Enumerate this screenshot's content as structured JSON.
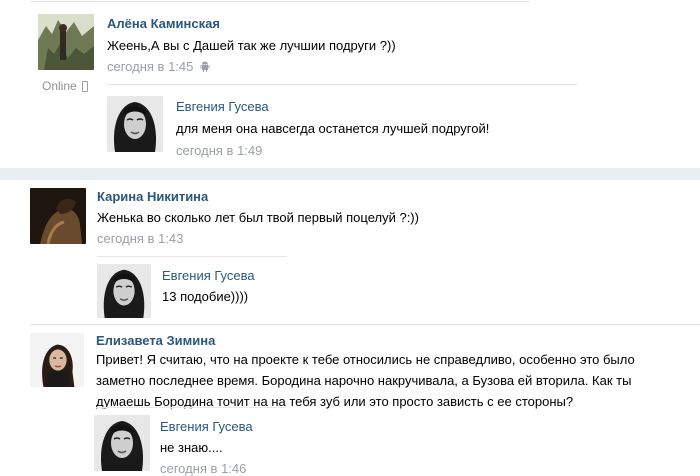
{
  "thread_1": {
    "author": "Алёна Каминская",
    "text": "Жеень,А вы с Дашей так же лучшии подруги ?))",
    "date": "сегодня в 1:45",
    "online": "Online",
    "reply": {
      "author": "Евгения Гусева",
      "text": "для меня она навсегда останется лучшей подругой!",
      "date": "сегодня в 1:49"
    }
  },
  "thread_2": {
    "author": "Карина Никитина",
    "text": "Женька во сколько лет был твой первый поцелуй ?:))",
    "date": "сегодня в 1:43",
    "reply": {
      "author": "Евгения Гусева",
      "text": "13 подобие))))"
    }
  },
  "thread_3": {
    "author": "Елизавета Зимина",
    "text": "Привет! Я считаю, что на проекте к тебе относились не справедливо, особенно это было заметно последнее время. Бородина нарочно накручивала, а Бузова ей вторила. Как ты думаешь Бородина точит на на тебя зуб или это просто зависть с ее стороны?",
    "reply": {
      "author": "Евгения Гусева",
      "text": "не знаю....",
      "date": "сегодня в 1:46"
    }
  },
  "colors": {
    "author": "#2b587a",
    "date": "#9aa0a6",
    "separator": "#dfe4ea",
    "gutter": "#e9eef4"
  }
}
